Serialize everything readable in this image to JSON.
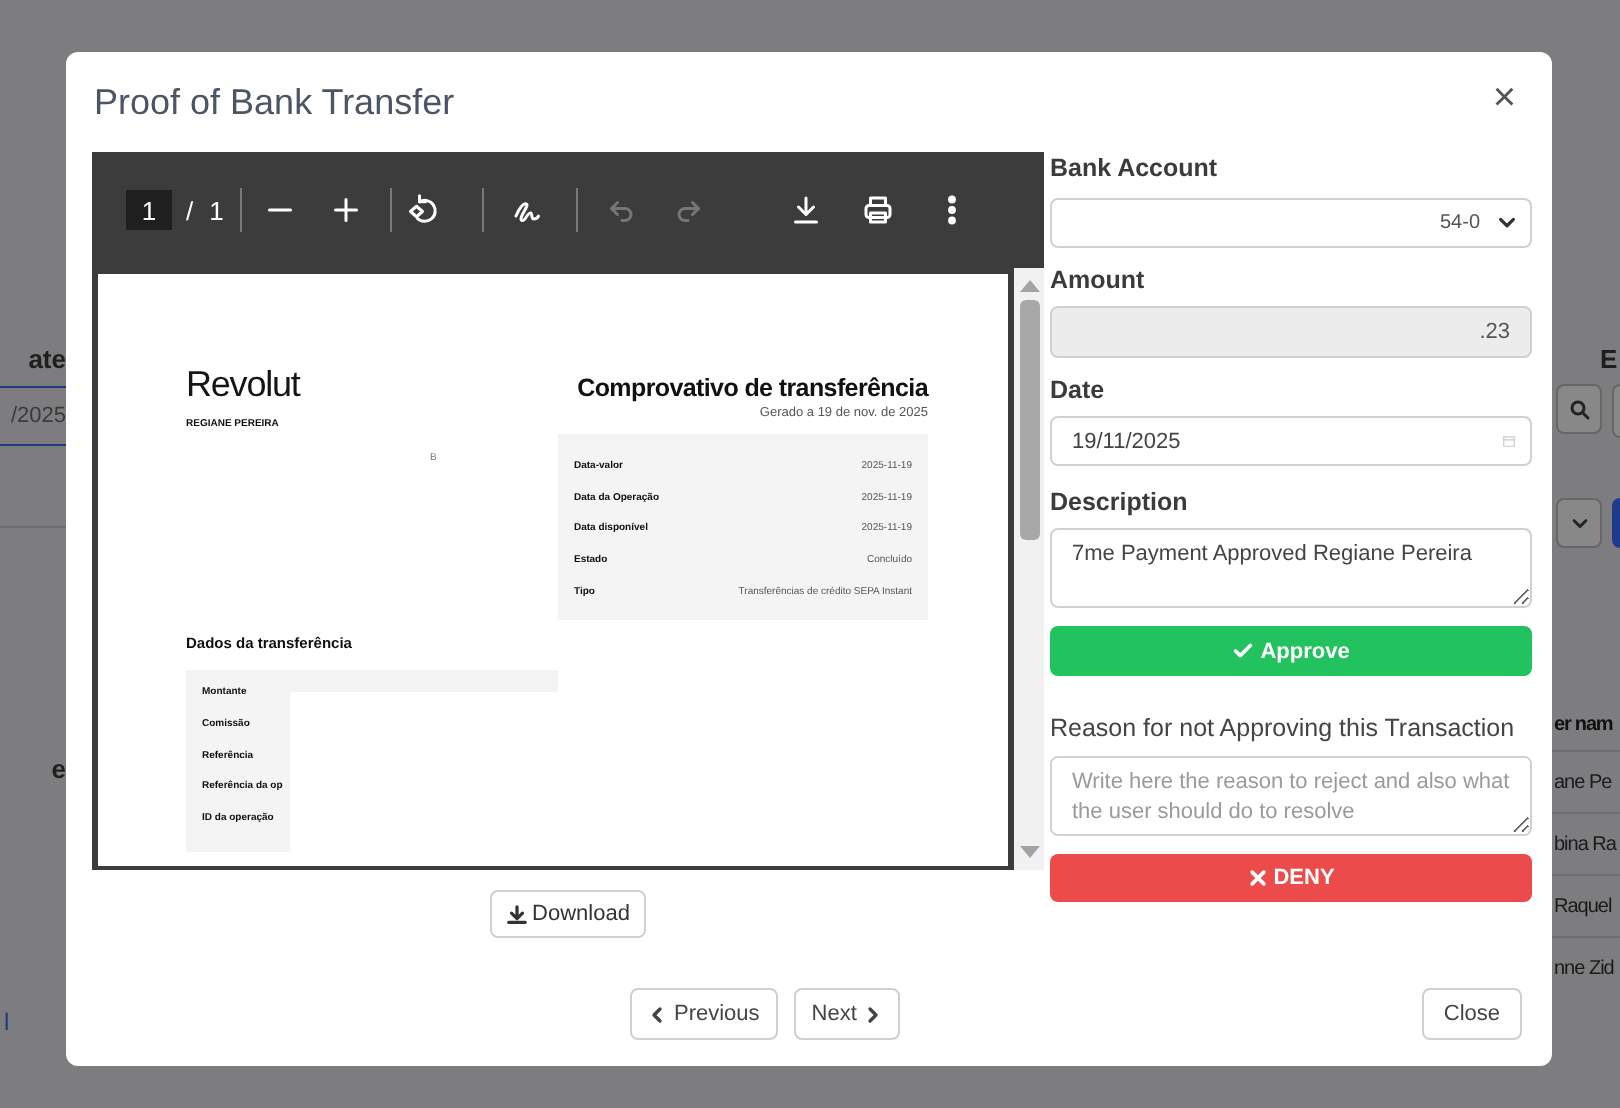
{
  "backdrop": {
    "left": {
      "column_header": "ate",
      "date_value": "/2025",
      "table_header": "e",
      "row_value": "l"
    },
    "right": {
      "column_header": "E",
      "table_header": "er nam",
      "rows": [
        "ane Pe",
        "bina Ra",
        "Raquel",
        "nne Zid"
      ]
    }
  },
  "modal": {
    "title": "Proof of Bank Transfer",
    "close_label": "×"
  },
  "viewer": {
    "page": "1",
    "separator": "/",
    "page_count": "1",
    "toolbar": [
      {
        "kind": "zoom-out",
        "disabled": false
      },
      {
        "kind": "zoom-in",
        "disabled": false
      },
      {
        "kind": "rotate",
        "disabled": false
      },
      {
        "kind": "draw",
        "disabled": false
      },
      {
        "kind": "undo",
        "disabled": true
      },
      {
        "kind": "redo",
        "disabled": true
      },
      {
        "kind": "download",
        "disabled": false
      },
      {
        "kind": "print",
        "disabled": false
      },
      {
        "kind": "more",
        "disabled": false
      }
    ],
    "document": {
      "brand": "Revolut",
      "customer": "REGIANE PEREIRA",
      "fragment": "B",
      "title": "Comprovativo de transferência",
      "generated": "Gerado a 19 de nov. de 2025",
      "summary": [
        {
          "label": "Data-valor",
          "value": "2025-11-19"
        },
        {
          "label": "Data da Operação",
          "value": "2025-11-19"
        },
        {
          "label": "Data disponível",
          "value": "2025-11-19"
        },
        {
          "label": "Estado",
          "value": "Concluído"
        },
        {
          "label": "Tipo",
          "value": "Transferências de crédito SEPA Instant"
        }
      ],
      "section_title": "Dados da transferência",
      "details": [
        "Montante",
        "Comissão",
        "Referência",
        "Referência da op",
        "ID da operação"
      ]
    }
  },
  "download_button": "Download",
  "form": {
    "bank_account": {
      "label": "Bank Account",
      "value": "54-0"
    },
    "amount": {
      "label": "Amount",
      "value": ".23",
      "disabled": true
    },
    "date": {
      "label": "Date",
      "value": "19/11/2025"
    },
    "description": {
      "label": "Description",
      "value": "7me Payment Approved Regiane Pereira"
    },
    "approve_button": "Approve",
    "reason": {
      "label": "Reason for not Approving this Transaction",
      "placeholder": "Write here the reason to reject and also what the user should do to resolve"
    },
    "deny_button": "DENY"
  },
  "footer": {
    "previous": "Previous",
    "next": "Next",
    "close": "Close"
  }
}
